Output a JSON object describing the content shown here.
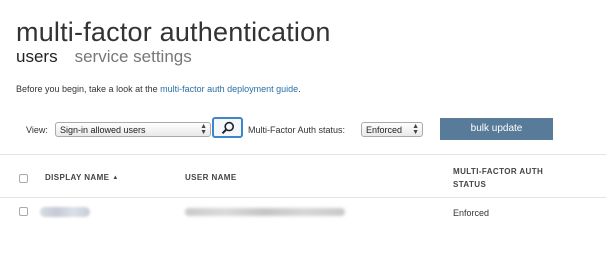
{
  "header": {
    "title": "multi-factor authentication",
    "tabs": [
      {
        "label": "users",
        "active": true
      },
      {
        "label": "service settings",
        "active": false
      }
    ]
  },
  "intro": {
    "text": "Before you begin, take a look at the ",
    "link": "multi-factor auth deployment guide",
    "suffix": "."
  },
  "filters": {
    "view_label": "View:",
    "view_value": "Sign-in allowed users",
    "mfa_status_label": "Multi-Factor Auth status:",
    "mfa_status_value": "Enforced",
    "search_icon": "search-icon",
    "bulk_update_label": "bulk update"
  },
  "table": {
    "columns": {
      "display_name": "DISPLAY NAME",
      "user_name": "USER NAME",
      "mfa_status": "MULTI-FACTOR AUTH STATUS"
    },
    "sort": {
      "column": "display_name",
      "direction": "ascending"
    },
    "rows": [
      {
        "mfa_status": "Enforced"
      }
    ]
  },
  "colors": {
    "link": "#2a6ea8",
    "button_bg": "#577b99",
    "search_border": "#3f86c9"
  }
}
